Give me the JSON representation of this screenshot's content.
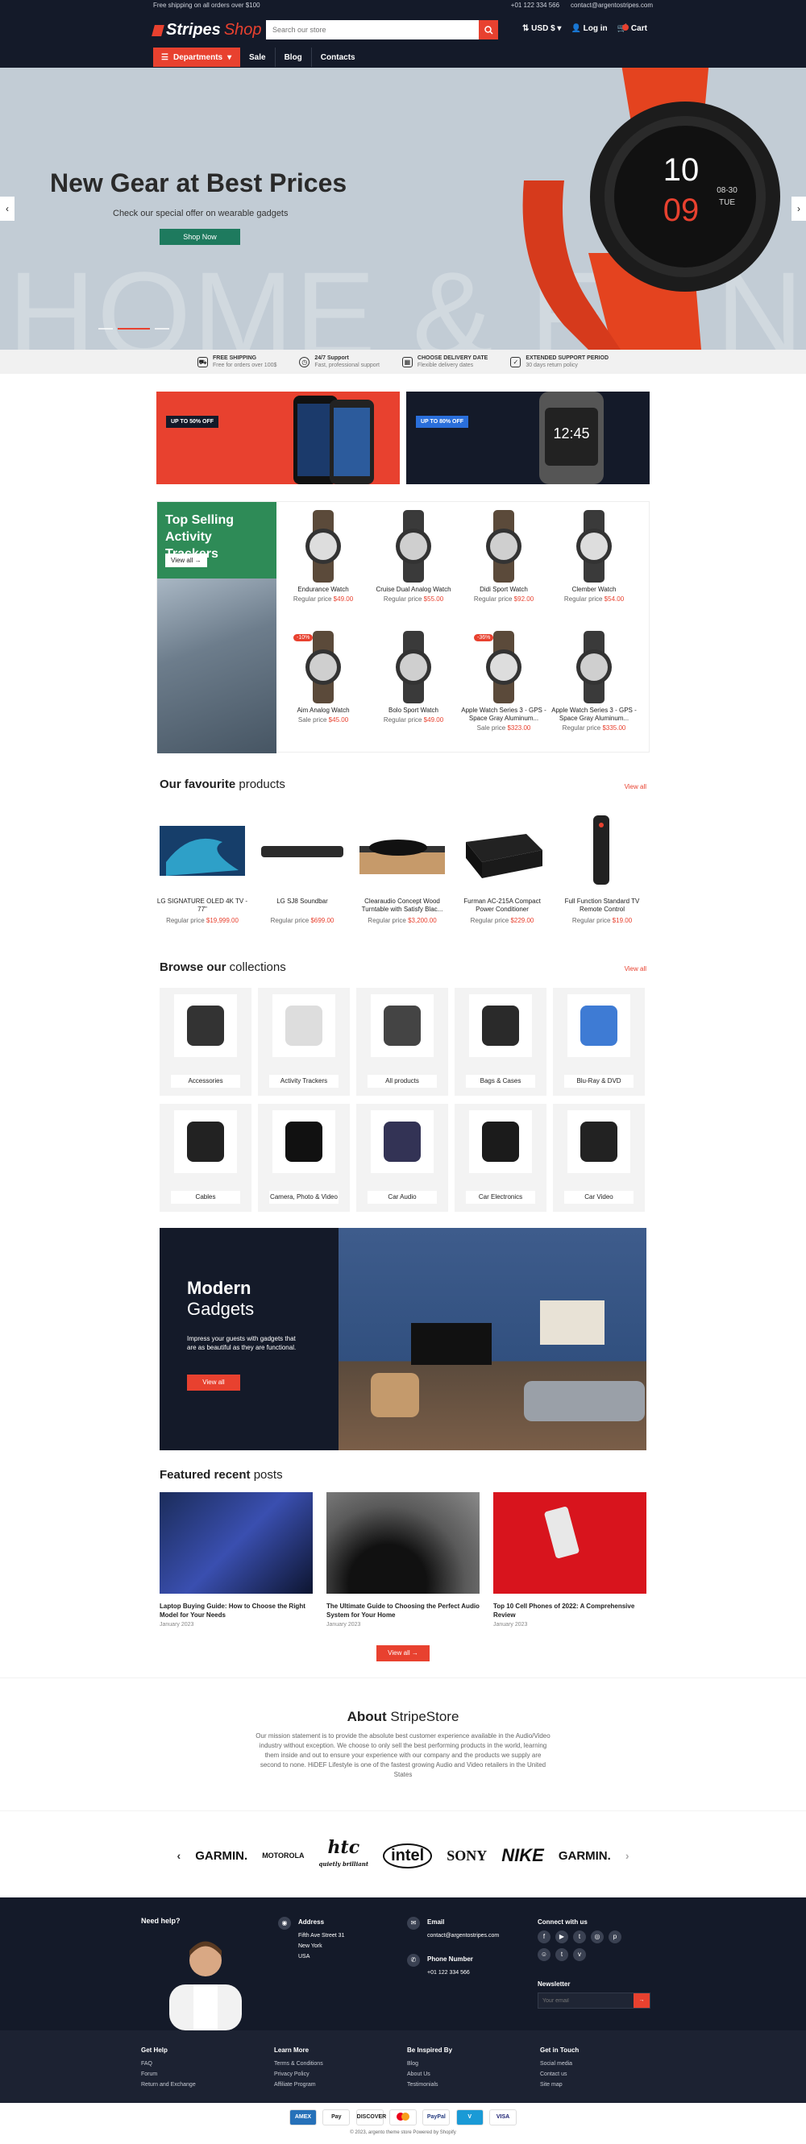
{
  "topbar": {
    "shipping": "Free shipping on all orders over $100",
    "phone": "+01 122 334 566",
    "email": "contact@argentostripes.com"
  },
  "header": {
    "logo_main": "Stripes",
    "logo_accent": "Shop",
    "search_placeholder": "Search our store",
    "currency": "USD $",
    "login": "Log in",
    "cart": "Cart"
  },
  "nav": {
    "departments": "Departments",
    "items": [
      "Sale",
      "Blog",
      "Contacts"
    ]
  },
  "hero": {
    "title": "New Gear at Best Prices",
    "subtitle": "Check our special offer on wearable gadgets",
    "button": "Shop Now",
    "bg_text": "HOME & FITNESS",
    "watch_time": "10",
    "watch_alt": "09",
    "watch_date": "08-30",
    "watch_day": "TUE"
  },
  "features": [
    {
      "title": "FREE SHIPPING",
      "sub": "Free for orders over 100$",
      "icon": "truck-icon"
    },
    {
      "title": "24/7 Support",
      "sub": "Fast, professional support",
      "icon": "clock-icon"
    },
    {
      "title": "CHOOSE DELIVERY DATE",
      "sub": "Flexible delivery dates",
      "icon": "calendar-icon"
    },
    {
      "title": "EXTENDED SUPPORT PERIOD",
      "sub": "30 days return policy",
      "icon": "shield-icon"
    }
  ],
  "banners": [
    {
      "tag": "UP TO 50% OFF",
      "color": "#e8412f"
    },
    {
      "tag": "UP TO 80% OFF",
      "color": "#2a6fdb"
    }
  ],
  "top_selling": {
    "title": "Top Selling Activity Trackers",
    "view_all": "View all",
    "products": [
      {
        "name": "Endurance Watch",
        "label": "Regular price",
        "price": "$49.00"
      },
      {
        "name": "Cruise Dual Analog Watch",
        "label": "Regular price",
        "price": "$55.00"
      },
      {
        "name": "Didi Sport Watch",
        "label": "Regular price",
        "price": "$92.00"
      },
      {
        "name": "Clember Watch",
        "label": "Regular price",
        "price": "$54.00"
      },
      {
        "name": "Aim Analog Watch",
        "label": "Sale price",
        "price": "$45.00",
        "badge": "-10%"
      },
      {
        "name": "Bolo Sport Watch",
        "label": "Regular price",
        "price": "$49.00"
      },
      {
        "name": "Apple Watch Series 3 - GPS - Space Gray Aluminum...",
        "label": "Sale price",
        "price": "$323.00",
        "badge": "-36%"
      },
      {
        "name": "Apple Watch Series 3 - GPS - Space Gray Aluminum...",
        "label": "Regular price",
        "price": "$335.00"
      }
    ]
  },
  "favourites": {
    "title_bold": "Our favourite",
    "title_rest": " products",
    "view_all": "View all",
    "products": [
      {
        "name": "LG SIGNATURE OLED 4K TV - 77\"",
        "label": "Regular price",
        "price": "$19,999.00"
      },
      {
        "name": "LG SJ8 Soundbar",
        "label": "Regular price",
        "price": "$699.00"
      },
      {
        "name": "Clearaudio Concept Wood Turntable with Satisfy Blac...",
        "label": "Regular price",
        "price": "$3,200.00"
      },
      {
        "name": "Furman AC-215A Compact Power Conditioner",
        "label": "Regular price",
        "price": "$229.00"
      },
      {
        "name": "Full Function Standard TV Remote Control",
        "label": "Regular price",
        "price": "$19.00"
      }
    ]
  },
  "collections": {
    "title_bold": "Browse our",
    "title_rest": " collections",
    "view_all": "View all",
    "items": [
      "Accessories",
      "Activity Trackers",
      "All products",
      "Bags & Cases",
      "Blu-Ray & DVD",
      "Cables",
      "Camera, Photo & Video",
      "Car Audio",
      "Car Electronics",
      "Car Video"
    ]
  },
  "modern": {
    "title": "Modern",
    "title2": "Gadgets",
    "text": "Impress your guests with gadgets that are as beautiful as they are functional.",
    "button": "View all"
  },
  "posts": {
    "title_bold": "Featured recent",
    "title_rest": " posts",
    "view_all": "View all",
    "items": [
      {
        "title": "Laptop Buying Guide: How to Choose the Right Model for Your Needs",
        "date": "January 2023"
      },
      {
        "title": "The Ultimate Guide to Choosing the Perfect Audio System for Your Home",
        "date": "January 2023"
      },
      {
        "title": "Top 10 Cell Phones of 2022: A Comprehensive Review",
        "date": "January 2023"
      }
    ]
  },
  "about": {
    "title_bold": "About",
    "title_rest": " StripeStore",
    "text": "Our mission statement is to provide the absolute best customer experience available in the Audio/Video industry without exception. We choose to only sell the best performing products in the world, learning them inside and out to ensure your experience with our company and the products we supply are second to none. HiDEF Lifestyle is one of the fastest growing Audio and Video retailers in the United States"
  },
  "brands": [
    "GARMIN.",
    "MOTOROLA",
    "htc",
    "intel",
    "SONY",
    "NIKE",
    "GARMIN."
  ],
  "brand_sub": "quietly brilliant",
  "footer": {
    "help": "Need help?",
    "address_title": "Address",
    "address": [
      "Fifth Ave Street 31",
      "New York",
      "USA"
    ],
    "email_title": "Email",
    "email": "contact@argentostripes.com",
    "phone_title": "Phone Number",
    "phone": "+01 122 334 566",
    "connect": "Connect with us",
    "newsletter": "Newsletter",
    "newsletter_placeholder": "Your email",
    "cols": [
      {
        "title": "Get Help",
        "links": [
          "FAQ",
          "Forum",
          "Return and Exchange"
        ]
      },
      {
        "title": "Learn More",
        "links": [
          "Terms & Conditions",
          "Privacy Policy",
          "Affiliate Program"
        ]
      },
      {
        "title": "Be Inspired By",
        "links": [
          "Blog",
          "About Us",
          "Testimonials"
        ]
      },
      {
        "title": "Get in Touch",
        "links": [
          "Social media",
          "Contact us",
          "Site map"
        ]
      }
    ],
    "payments": [
      "AMEX",
      "Pay",
      "DISCOVER",
      "MC",
      "PayPal",
      "V",
      "VISA"
    ],
    "copyright": "© 2023, argento theme store Powered by Shopify"
  }
}
